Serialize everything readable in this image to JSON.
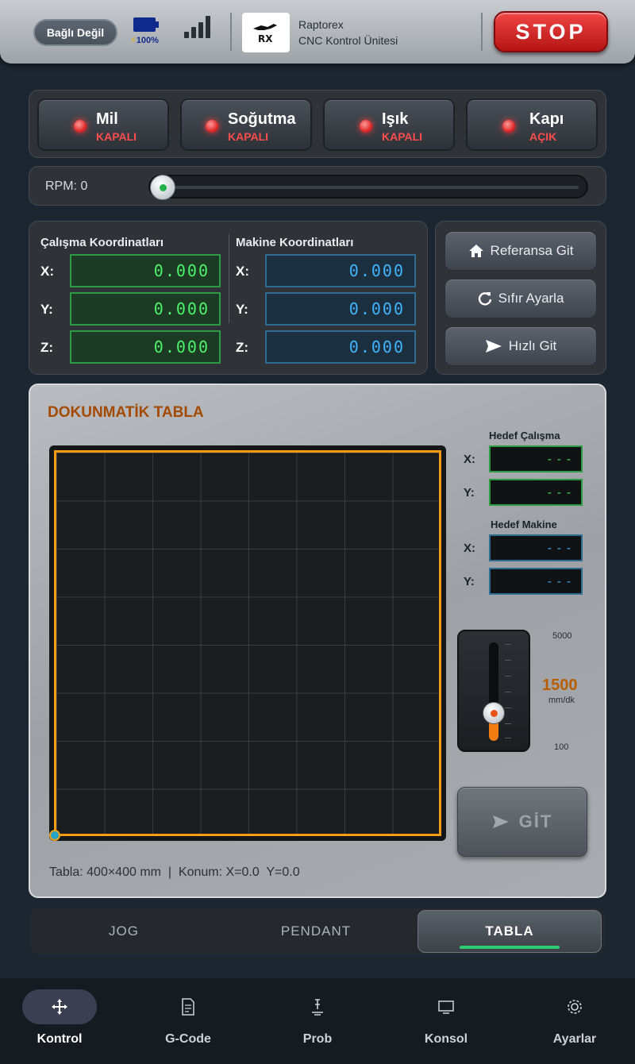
{
  "header": {
    "connection_status": "Bağlı Değil",
    "battery_percent": "100%",
    "brand_name": "Raptorex",
    "brand_subtitle": "CNC Kontrol Ünitesi",
    "logo_text": "RX",
    "stop_label": "STOP"
  },
  "toggles": [
    {
      "name": "Mil",
      "state": "KAPALI"
    },
    {
      "name": "Soğutma",
      "state": "KAPALI"
    },
    {
      "name": "Işık",
      "state": "KAPALI"
    },
    {
      "name": "Kapı",
      "state": "AÇIK"
    }
  ],
  "rpm": {
    "label": "RPM: 0",
    "value": 0
  },
  "coordinates": {
    "work_title": "Çalışma Koordinatları",
    "machine_title": "Makine Koordinatları",
    "work": {
      "x": "0.000",
      "y": "0.000",
      "z": "0.000"
    },
    "machine": {
      "x": "0.000",
      "y": "0.000",
      "z": "0.000"
    },
    "axis_x": "X:",
    "axis_y": "Y:",
    "axis_z": "Z:"
  },
  "actions": {
    "home": "Referansa Git",
    "zero": "Sıfır Ayarla",
    "rapid": "Hızlı Git"
  },
  "touch_table": {
    "title": "DOKUNMATİK TABLA",
    "info": "Tabla: 400×400 mm  |  Konum: X=0.0  Y=0.0",
    "target_work_title": "Hedef Çalışma",
    "target_machine_title": "Hedef Makine",
    "target_work": {
      "x": "---",
      "y": "---"
    },
    "target_machine": {
      "x": "---",
      "y": "---"
    },
    "axis_x": "X:",
    "axis_y": "Y:",
    "feed": {
      "max": "5000",
      "min": "100",
      "value": "1500",
      "unit": "mm/dk",
      "fraction": 0.286
    },
    "go_label": "GİT"
  },
  "mode_tabs": [
    {
      "label": "JOG",
      "active": false
    },
    {
      "label": "PENDANT",
      "active": false
    },
    {
      "label": "TABLA",
      "active": true
    }
  ],
  "bottom_nav": [
    {
      "label": "Kontrol",
      "icon": "move-icon",
      "active": true
    },
    {
      "label": "G-Code",
      "icon": "gcode-file-icon",
      "active": false
    },
    {
      "label": "Prob",
      "icon": "probe-icon",
      "active": false
    },
    {
      "label": "Konsol",
      "icon": "console-icon",
      "active": false
    },
    {
      "label": "Ayarlar",
      "icon": "settings-icon",
      "active": false
    }
  ],
  "colors": {
    "stop": "#d82020",
    "led_off": "#e02a2a",
    "work_coord": "#4cf26b",
    "machine_coord": "#42b4ff",
    "accent_orange": "#f39c12",
    "active_tab_indicator": "#2ecc71"
  }
}
